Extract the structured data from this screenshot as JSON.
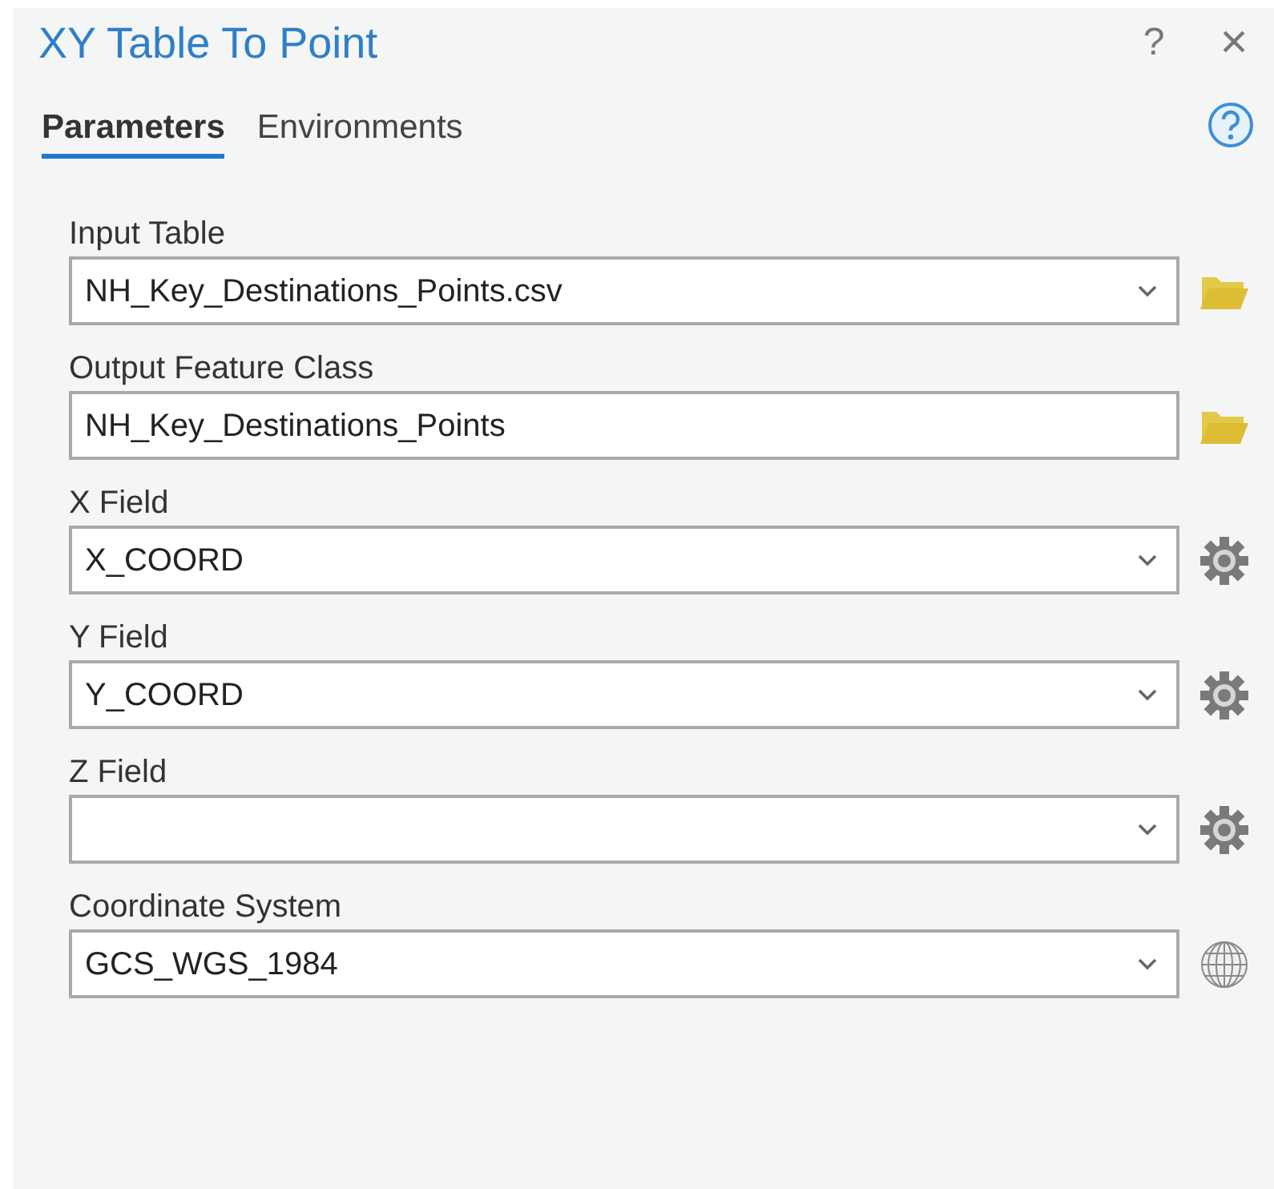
{
  "window": {
    "title": "XY Table To Point",
    "help": "?",
    "close": "×"
  },
  "tabs": [
    {
      "label": "Parameters",
      "selected": true
    },
    {
      "label": "Environments",
      "selected": false
    }
  ],
  "parameters": [
    {
      "label": "Input Table",
      "value": "NH_Key_Destinations_Points.csv",
      "kind": "table"
    },
    {
      "label": "Output Feature Class",
      "value": "NH_Key_Destinations_Points",
      "kind": "output"
    },
    {
      "label": "X Field",
      "value": "X_COORD",
      "kind": "field"
    },
    {
      "label": "Y Field",
      "value": "Y_COORD",
      "kind": "field"
    },
    {
      "label": "Z Field",
      "kind": "field"
    },
    {
      "label": "Coordinate System",
      "value": "GCS_WGS_1984",
      "kind": "crs"
    }
  ]
}
